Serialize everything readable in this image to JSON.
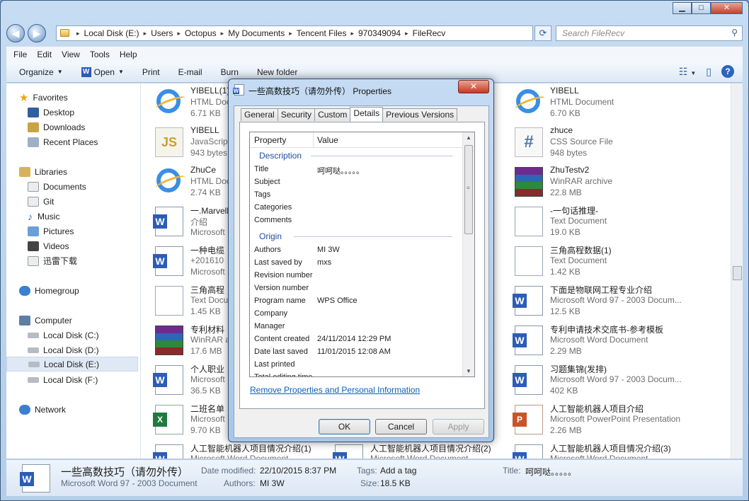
{
  "window": {
    "title_buttons": {
      "minimize": "▁",
      "maximize": "□",
      "close": "✕"
    }
  },
  "address": {
    "back_icon": "back-arrow-icon",
    "forward_icon": "forward-arrow-icon",
    "crumbs": [
      "Local Disk (E:)",
      "Users",
      "Octopus",
      "My Documents",
      "Tencent Files",
      "970349094",
      "FileRecv"
    ],
    "search_placeholder": "Search FileRecv"
  },
  "menu": [
    "File",
    "Edit",
    "View",
    "Tools",
    "Help"
  ],
  "toolbar": {
    "organize": "Organize",
    "open": "Open",
    "print": "Print",
    "email": "E-mail",
    "burn": "Burn",
    "new_folder": "New folder"
  },
  "nav": {
    "favorites": "Favorites",
    "desktop": "Desktop",
    "downloads": "Downloads",
    "recent": "Recent Places",
    "libraries": "Libraries",
    "documents": "Documents",
    "git": "Git",
    "music": "Music",
    "pictures": "Pictures",
    "videos": "Videos",
    "thunder": "迅雷下载",
    "homegroup": "Homegroup",
    "computer": "Computer",
    "disk_c": "Local Disk (C:)",
    "disk_d": "Local Disk (D:)",
    "disk_e": "Local Disk (E:)",
    "disk_f": "Local Disk (F:)",
    "network": "Network"
  },
  "files": {
    "col1": [
      {
        "name": "YIBELL(1)",
        "type": "HTML Doc",
        "size": "6.71 KB",
        "icon": "ie"
      },
      {
        "name": "YIBELL",
        "type": "JavaScript",
        "size": "943 bytes",
        "icon": "js"
      },
      {
        "name": "ZhuCe",
        "type": "HTML Doc",
        "size": "2.74 KB",
        "icon": "ie"
      },
      {
        "name": "一.Marvell",
        "type": "介绍",
        "size": "Microsoft",
        "icon": "word"
      },
      {
        "name": "一种电缆",
        "type": "+201610",
        "size": "Microsoft",
        "icon": "word"
      },
      {
        "name": "三角高程",
        "type": "Text Docu",
        "size": "1.45 KB",
        "icon": "doc"
      },
      {
        "name": "专利材料",
        "type": "WinRAR a",
        "size": "17.6 MB",
        "icon": "rar"
      },
      {
        "name": "个人职业",
        "type": "Microsoft",
        "size": "36.5 KB",
        "icon": "word"
      },
      {
        "name": "二班名单",
        "type": "Microsoft",
        "size": "9.70 KB",
        "icon": "xls"
      },
      {
        "name": "人工智能机器人项目情况介绍(1)",
        "type": "Microsoft Word Document",
        "size": "",
        "icon": "word"
      }
    ],
    "col2_bottom": {
      "name": "人工智能机器人项目情况介绍(2)",
      "type": "Microsoft Word Document",
      "icon": "word"
    },
    "col3": [
      {
        "name": "YIBELL",
        "type": "HTML Document",
        "size": "6.70 KB",
        "icon": "ie"
      },
      {
        "name": "zhuce",
        "type": "CSS Source File",
        "size": "948 bytes",
        "icon": "css"
      },
      {
        "name": "ZhuTestv2",
        "type": "WinRAR archive",
        "size": "22.8 MB",
        "icon": "rar"
      },
      {
        "name": "-一句话推理-",
        "type": "Text Document",
        "size": "19.0 KB",
        "icon": "doc"
      },
      {
        "name": "三角高程数据(1)",
        "type": "Text Document",
        "size": "1.42 KB",
        "icon": "doc"
      },
      {
        "name": "下面是物联网工程专业介绍",
        "type": "Microsoft Word 97 - 2003 Docum...",
        "size": "12.5 KB",
        "icon": "word"
      },
      {
        "name": "专利申请技术交底书-参考模板",
        "type": "Microsoft Word Document",
        "size": "2.29 MB",
        "icon": "word"
      },
      {
        "name": "习题集锦(发排)",
        "type": "Microsoft Word 97 - 2003 Docum...",
        "size": "402 KB",
        "icon": "word"
      },
      {
        "name": "人工智能机器人项目介绍",
        "type": "Microsoft PowerPoint Presentation",
        "size": "2.26 MB",
        "icon": "ppt"
      },
      {
        "name": "人工智能机器人项目情况介绍(3)",
        "type": "Microsoft Word Document",
        "size": "",
        "icon": "word"
      }
    ]
  },
  "details_pane": {
    "name": "一些高数技巧（请勿外传）",
    "type": "Microsoft Word 97 - 2003 Document",
    "date_label": "Date modified:",
    "date": "22/10/2015 8:37 PM",
    "authors_label": "Authors:",
    "authors": "MI 3W",
    "tags_label": "Tags:",
    "tags": "Add a tag",
    "size_label": "Size:",
    "size": "18.5 KB",
    "title_label": "Title:",
    "title": "呵呵哒。。。。。"
  },
  "dialog": {
    "title": "一些高数技巧（请勿外传） Properties",
    "close": "✕",
    "tabs": [
      "General",
      "Security",
      "Custom",
      "Details",
      "Previous Versions"
    ],
    "active_tab": "Details",
    "col_property": "Property",
    "col_value": "Value",
    "group_description": "Description",
    "group_origin": "Origin",
    "props": [
      {
        "k": "Title",
        "v": "呵呵哒。。。。。"
      },
      {
        "k": "Subject",
        "v": ""
      },
      {
        "k": "Tags",
        "v": ""
      },
      {
        "k": "Categories",
        "v": ""
      },
      {
        "k": "Comments",
        "v": ""
      },
      {
        "k": "Authors",
        "v": "MI 3W"
      },
      {
        "k": "Last saved by",
        "v": "mxs"
      },
      {
        "k": "Revision number",
        "v": ""
      },
      {
        "k": "Version number",
        "v": ""
      },
      {
        "k": "Program name",
        "v": "WPS Office"
      },
      {
        "k": "Company",
        "v": ""
      },
      {
        "k": "Manager",
        "v": ""
      },
      {
        "k": "Content created",
        "v": "24/11/2014 12:29 PM"
      },
      {
        "k": "Date last saved",
        "v": "11/01/2015 12:08 AM"
      },
      {
        "k": "Last printed",
        "v": ""
      },
      {
        "k": "Total editing time",
        "v": ""
      }
    ],
    "remove_link": "Remove Properties and Personal Information",
    "ok": "OK",
    "cancel": "Cancel",
    "apply": "Apply"
  }
}
